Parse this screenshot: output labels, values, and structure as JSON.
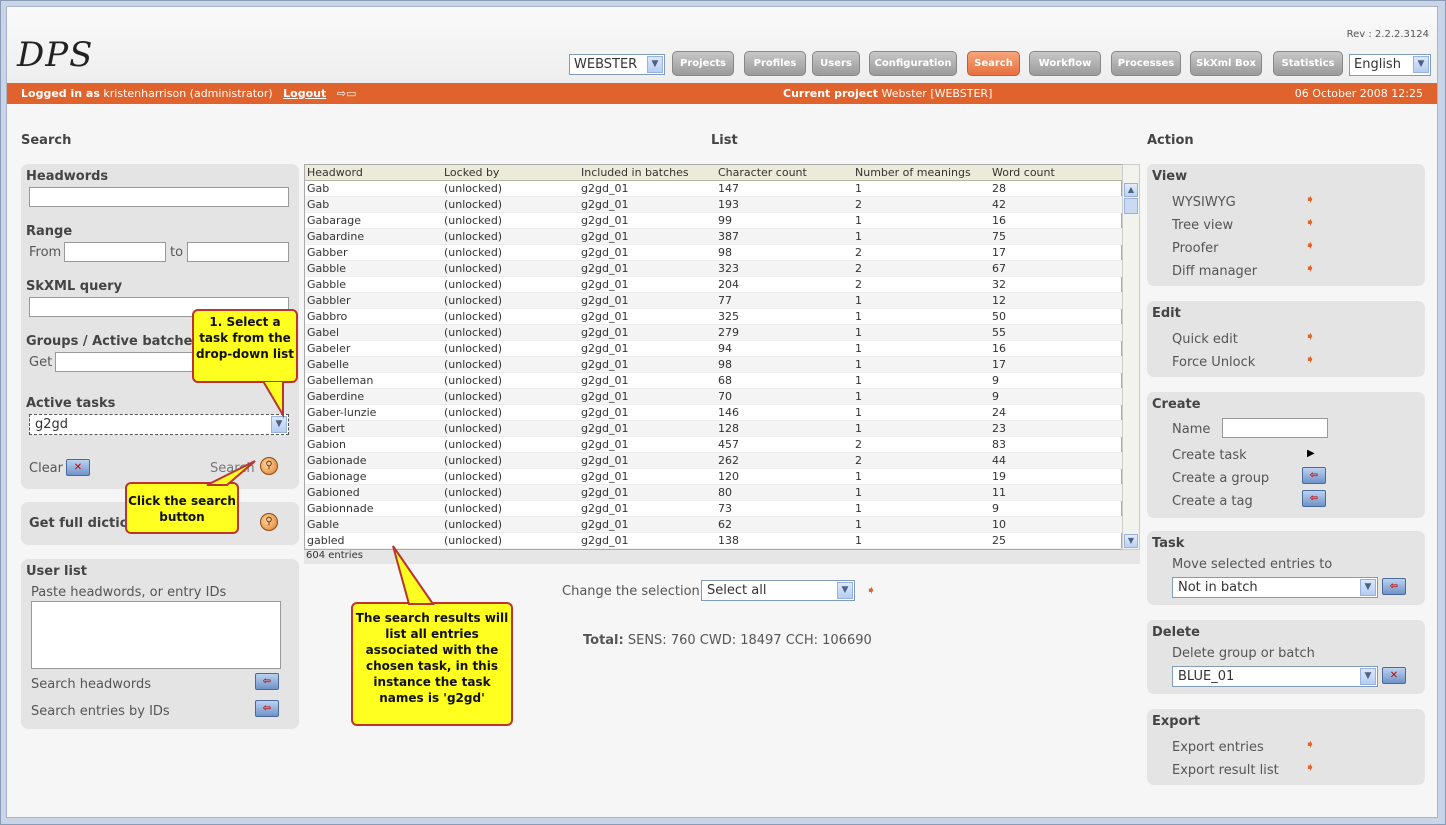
{
  "header": {
    "logo": "DPS",
    "revision": "Rev : 2.2.2.3124",
    "project_select": "WEBSTER",
    "nav": [
      "Projects",
      "Profiles",
      "Users",
      "Configuration",
      "Search",
      "Workflow",
      "Processes",
      "SkXml Box",
      "Statistics"
    ],
    "active_nav": "Search",
    "language": "English"
  },
  "statusbar": {
    "logged_in_label": "Logged in as",
    "user": "kristenharrison (administrator)",
    "logout": "Logout",
    "current_project_label": "Current project",
    "current_project": "Webster [WEBSTER]",
    "date": "06 October 2008 12:25"
  },
  "search": {
    "title": "Search",
    "headwords_label": "Headwords",
    "range_label": "Range",
    "from_label": "From",
    "to_label": "to",
    "skxml_label": "SkXML query",
    "groups_label": "Groups / Active batches",
    "get_label": "Get",
    "active_tasks_label": "Active tasks",
    "active_task_value": "g2gd",
    "clear_label": "Clear",
    "search_label": "Search",
    "full_dict_label": "Get full diction",
    "userlist_title": "User list",
    "userlist_hint": "Paste headwords, or entry IDs",
    "search_headwords": "Search headwords",
    "search_entries_ids": "Search entries by IDs"
  },
  "list": {
    "title": "List",
    "columns": [
      "Headword",
      "Locked by",
      "Included in batches",
      "Character count",
      "Number of meanings",
      "Word count"
    ],
    "rows": [
      [
        "Gab",
        "(unlocked)",
        "g2gd_01",
        "147",
        "1",
        "28"
      ],
      [
        "Gab",
        "(unlocked)",
        "g2gd_01",
        "193",
        "2",
        "42"
      ],
      [
        "Gabarage",
        "(unlocked)",
        "g2gd_01",
        "99",
        "1",
        "16"
      ],
      [
        "Gabardine",
        "(unlocked)",
        "g2gd_01",
        "387",
        "1",
        "75"
      ],
      [
        "Gabber",
        "(unlocked)",
        "g2gd_01",
        "98",
        "2",
        "17"
      ],
      [
        "Gabble",
        "(unlocked)",
        "g2gd_01",
        "323",
        "2",
        "67"
      ],
      [
        "Gabble",
        "(unlocked)",
        "g2gd_01",
        "204",
        "2",
        "32"
      ],
      [
        "Gabbler",
        "(unlocked)",
        "g2gd_01",
        "77",
        "1",
        "12"
      ],
      [
        "Gabbro",
        "(unlocked)",
        "g2gd_01",
        "325",
        "1",
        "50"
      ],
      [
        "Gabel",
        "(unlocked)",
        "g2gd_01",
        "279",
        "1",
        "55"
      ],
      [
        "Gabeler",
        "(unlocked)",
        "g2gd_01",
        "94",
        "1",
        "16"
      ],
      [
        "Gabelle",
        "(unlocked)",
        "g2gd_01",
        "98",
        "1",
        "17"
      ],
      [
        "Gabelleman",
        "(unlocked)",
        "g2gd_01",
        "68",
        "1",
        "9"
      ],
      [
        "Gaberdine",
        "(unlocked)",
        "g2gd_01",
        "70",
        "1",
        "9"
      ],
      [
        "Gaber-lunzie",
        "(unlocked)",
        "g2gd_01",
        "146",
        "1",
        "24"
      ],
      [
        "Gabert",
        "(unlocked)",
        "g2gd_01",
        "128",
        "1",
        "23"
      ],
      [
        "Gabion",
        "(unlocked)",
        "g2gd_01",
        "457",
        "2",
        "83"
      ],
      [
        "Gabionade",
        "(unlocked)",
        "g2gd_01",
        "262",
        "2",
        "44"
      ],
      [
        "Gabionage",
        "(unlocked)",
        "g2gd_01",
        "120",
        "1",
        "19"
      ],
      [
        "Gabioned",
        "(unlocked)",
        "g2gd_01",
        "80",
        "1",
        "11"
      ],
      [
        "Gabionnade",
        "(unlocked)",
        "g2gd_01",
        "73",
        "1",
        "9"
      ],
      [
        "Gable",
        "(unlocked)",
        "g2gd_01",
        "62",
        "1",
        "10"
      ],
      [
        "gabled",
        "(unlocked)",
        "g2gd_01",
        "138",
        "1",
        "25"
      ]
    ],
    "entries_count": "604 entries",
    "change_selection_label": "Change the selection",
    "change_selection_value": "Select all",
    "total_label": "Total:",
    "total_value": "SENS: 760 CWD: 18497 CCH: 106690"
  },
  "action": {
    "title": "Action",
    "view_title": "View",
    "view_items": [
      "WYSIWYG",
      "Tree view",
      "Proofer",
      "Diff manager"
    ],
    "edit_title": "Edit",
    "edit_items": [
      "Quick edit",
      "Force Unlock"
    ],
    "create_title": "Create",
    "name_label": "Name",
    "create_task": "Create task",
    "create_group": "Create a group",
    "create_tag": "Create a tag",
    "task_title": "Task",
    "move_label": "Move selected entries to",
    "move_value": "Not in batch",
    "delete_title": "Delete",
    "delete_label": "Delete group or batch",
    "delete_value": "BLUE_01",
    "export_title": "Export",
    "export_items": [
      "Export entries",
      "Export result list"
    ]
  },
  "callouts": {
    "select_task": "1. Select a task from the drop-down list",
    "click_search": "Click the search button",
    "results": "The search results will list all entries associated with the chosen task, in this instance the task names is 'g2gd'"
  }
}
